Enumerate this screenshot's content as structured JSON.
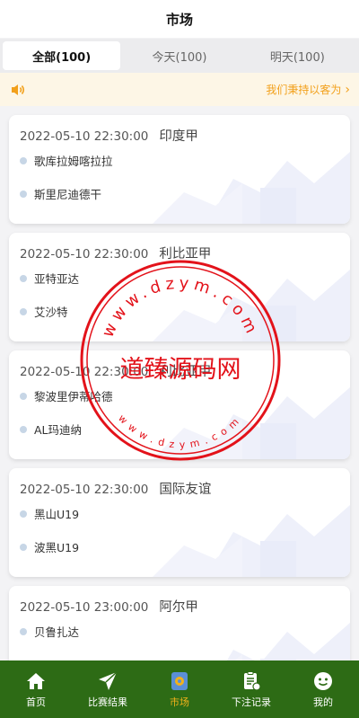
{
  "header": {
    "title": "市场"
  },
  "tabs": [
    {
      "label": "全部(100)",
      "active": true
    },
    {
      "label": "今天(100)",
      "active": false
    },
    {
      "label": "明天(100)",
      "active": false
    }
  ],
  "notice": {
    "text": "我们秉持以客为",
    "icon": "speaker-icon"
  },
  "matches": [
    {
      "time": "2022-05-10 22:30:00",
      "league": "印度甲",
      "team1": "歌库拉姆喀拉拉",
      "team2": "斯里尼迪德干"
    },
    {
      "time": "2022-05-10 22:30:00",
      "league": "利比亚甲",
      "team1": "亚特亚达",
      "team2": "艾沙特"
    },
    {
      "time": "2022-05-10 22:30:00",
      "league": "利比亚甲",
      "team1": "黎波里伊蒂哈德",
      "team2": "AL玛迪纳"
    },
    {
      "time": "2022-05-10 22:30:00",
      "league": "国际友谊",
      "team1": "黑山U19",
      "team2": "波黑U19"
    },
    {
      "time": "2022-05-10 23:00:00",
      "league": "阿尔甲",
      "team1": "贝鲁扎达",
      "team2": ""
    }
  ],
  "watermark": {
    "center_text": "道臻源码网",
    "ring_text_outer": "www.dzym.com",
    "ring_text_inner": "www.dzym.com",
    "color": "#e3121a"
  },
  "nav": [
    {
      "label": "首页",
      "icon": "home-icon",
      "active": false
    },
    {
      "label": "比赛结果",
      "icon": "paper-plane-icon",
      "active": false
    },
    {
      "label": "市场",
      "icon": "market-icon",
      "active": true
    },
    {
      "label": "下注记录",
      "icon": "clipboard-icon",
      "active": false
    },
    {
      "label": "我的",
      "icon": "smiley-icon",
      "active": false
    }
  ],
  "colors": {
    "nav_bg": "#2d6b15",
    "accent": "#f2b21b",
    "notice_text": "#f2a01b",
    "notice_bg": "#fdf6e6"
  }
}
